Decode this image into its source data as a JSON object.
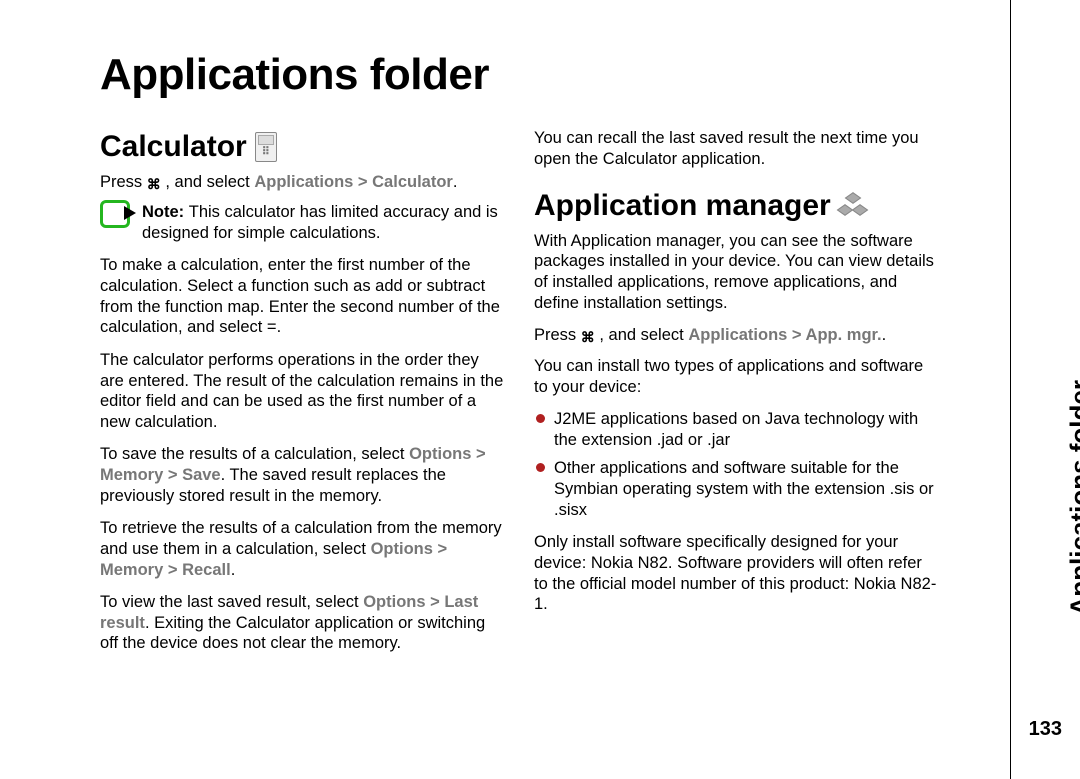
{
  "mainTitle": "Applications folder",
  "sideTab": "Applications folder",
  "pageNumber": "133",
  "calc": {
    "heading": "Calculator",
    "pressPrefix": "Press ",
    "pressMid": " , and select ",
    "path": "Applications  >  Calculator",
    "pressSuffix": ".",
    "noteLabel": "Note:  ",
    "noteText": "This calculator has limited accuracy and is designed for simple calculations.",
    "p1": "To make a calculation, enter the first number of the calculation. Select a function such as add or subtract from the function map. Enter the second number of the calculation, and select =.",
    "p2": "The calculator performs operations in the order they are entered. The result of the calculation remains in the editor field and can be used as the first number of a new calculation.",
    "p3a": "To save the results of a calculation, select ",
    "p3path": "Options  > Memory  >  Save",
    "p3b": ". The saved result replaces the previously stored result in the memory.",
    "p4a": "To retrieve the results of a calculation from the memory and use them in a calculation, select ",
    "p4path": "Options  >  Memory  >  Recall",
    "p4b": ".",
    "p5a": "To view the last saved result, select ",
    "p5path": "Options  >  Last result",
    "p5b": ". Exiting the Calculator application or switching off the device does not clear the memory."
  },
  "col2": {
    "topPara": "You can recall the last saved result the next time you open the Calculator application.",
    "appmgr": {
      "heading": "Application manager",
      "desc": "With Application manager, you can see the software packages installed in your device. You can view details of installed applications, remove applications, and define installation settings.",
      "pressPrefix": "Press ",
      "pressMid": " , and select ",
      "path": "Applications  >  App. mgr.",
      "pressSuffix": ".",
      "twoTypesIntro": "You can install two types of applications and software to your device:",
      "bullets": [
        "J2ME applications based on Java technology with the extension .jad or .jar",
        "Other applications and software suitable for the Symbian operating system with the extension .sis or .sisx"
      ],
      "footer": "Only install software specifically designed for your device: Nokia N82. Software providers will often refer to the official model number of this product: Nokia N82-1."
    }
  }
}
